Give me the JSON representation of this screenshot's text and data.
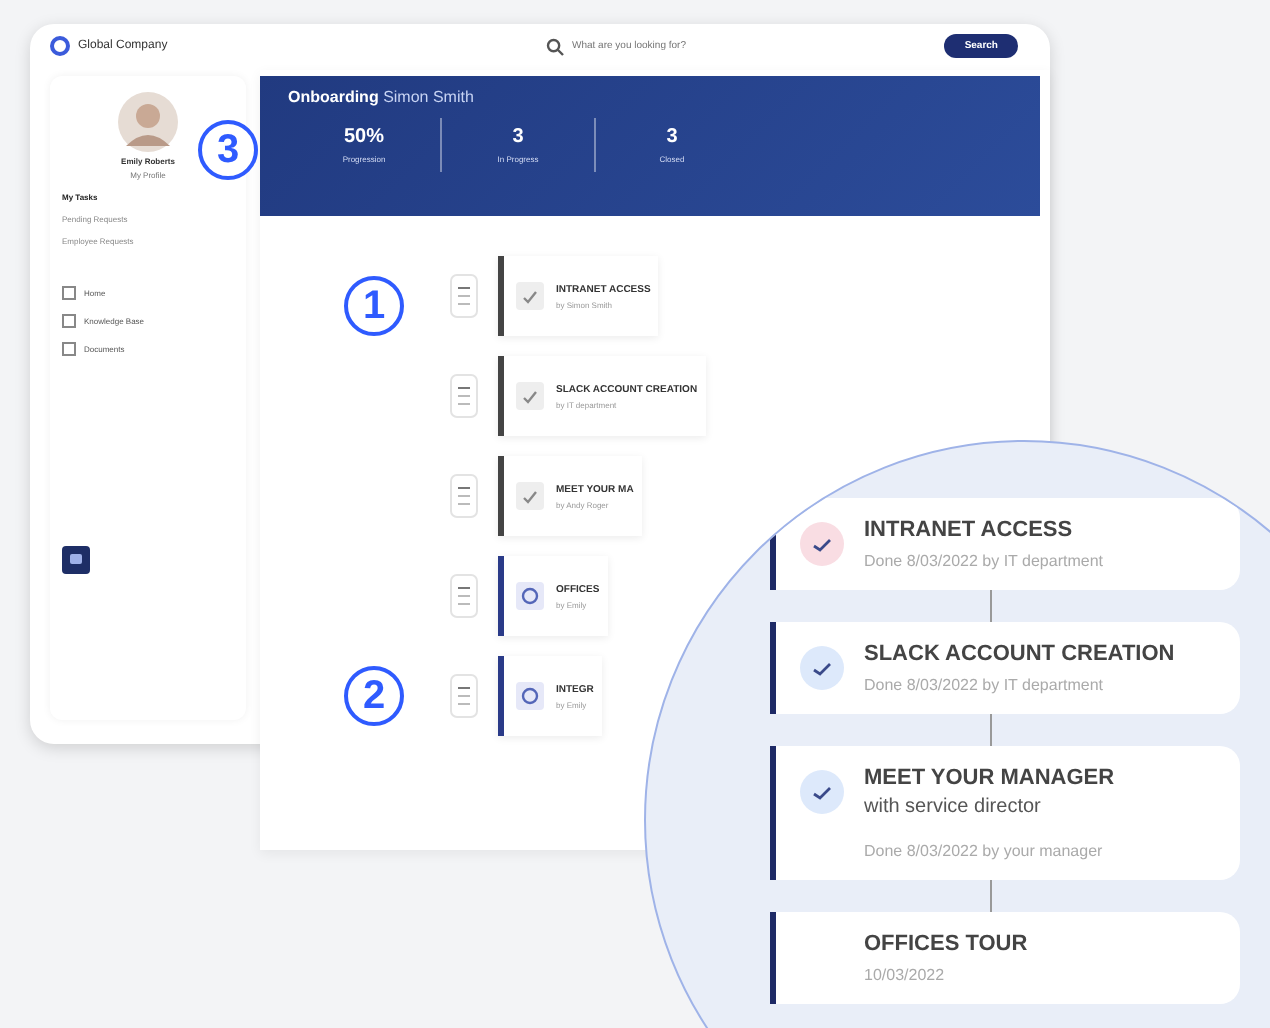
{
  "topbar": {
    "brand": "Global Company",
    "search": {
      "placeholder": "What are you looking for?"
    },
    "search_button": "Search"
  },
  "sidebar": {
    "profile": {
      "name": "Emily Roberts",
      "subtitle": "My Profile"
    },
    "items": [
      {
        "label": "My Tasks",
        "selected": true
      },
      {
        "label": "Pending Requests",
        "selected": false
      },
      {
        "label": "Employee Requests",
        "selected": false
      }
    ],
    "links": [
      {
        "label": "Home"
      },
      {
        "label": "Knowledge Base"
      },
      {
        "label": "Documents"
      }
    ]
  },
  "banner": {
    "title": "Onboarding",
    "person": "Simon Smith",
    "stats": [
      {
        "value": "50%",
        "label": "Progression"
      },
      {
        "value": "3",
        "label": "In Progress"
      },
      {
        "value": "3",
        "label": "Closed"
      }
    ]
  },
  "timeline": [
    {
      "title": "INTRANET ACCESS",
      "subtitle": "by Simon Smith",
      "done": true
    },
    {
      "title": "SLACK ACCOUNT CREATION",
      "subtitle": "by IT department",
      "done": true
    },
    {
      "title": "MEET YOUR MA",
      "subtitle": "by Andy Roger",
      "done": true
    },
    {
      "title": "OFFICES",
      "subtitle": "by Emily",
      "done": false
    },
    {
      "title": "INTEGR",
      "subtitle": "by Emily",
      "done": false
    }
  ],
  "magnifier": {
    "items": [
      {
        "title": "INTRANET ACCESS",
        "note": "Done 8/03/2022 by IT department",
        "color": "#f9dde3"
      },
      {
        "title": "SLACK ACCOUNT CREATION",
        "note": "Done 8/03/2022 by IT department",
        "color": "#dde9fb"
      },
      {
        "title": "MEET YOUR MANAGER",
        "detail": "with service director",
        "note": "Done 8/03/2022 by your manager",
        "color": "#dde9fb"
      },
      {
        "title": "OFFICES TOUR",
        "note": "10/03/2022"
      }
    ]
  },
  "callouts": [
    "1",
    "2",
    "3"
  ]
}
